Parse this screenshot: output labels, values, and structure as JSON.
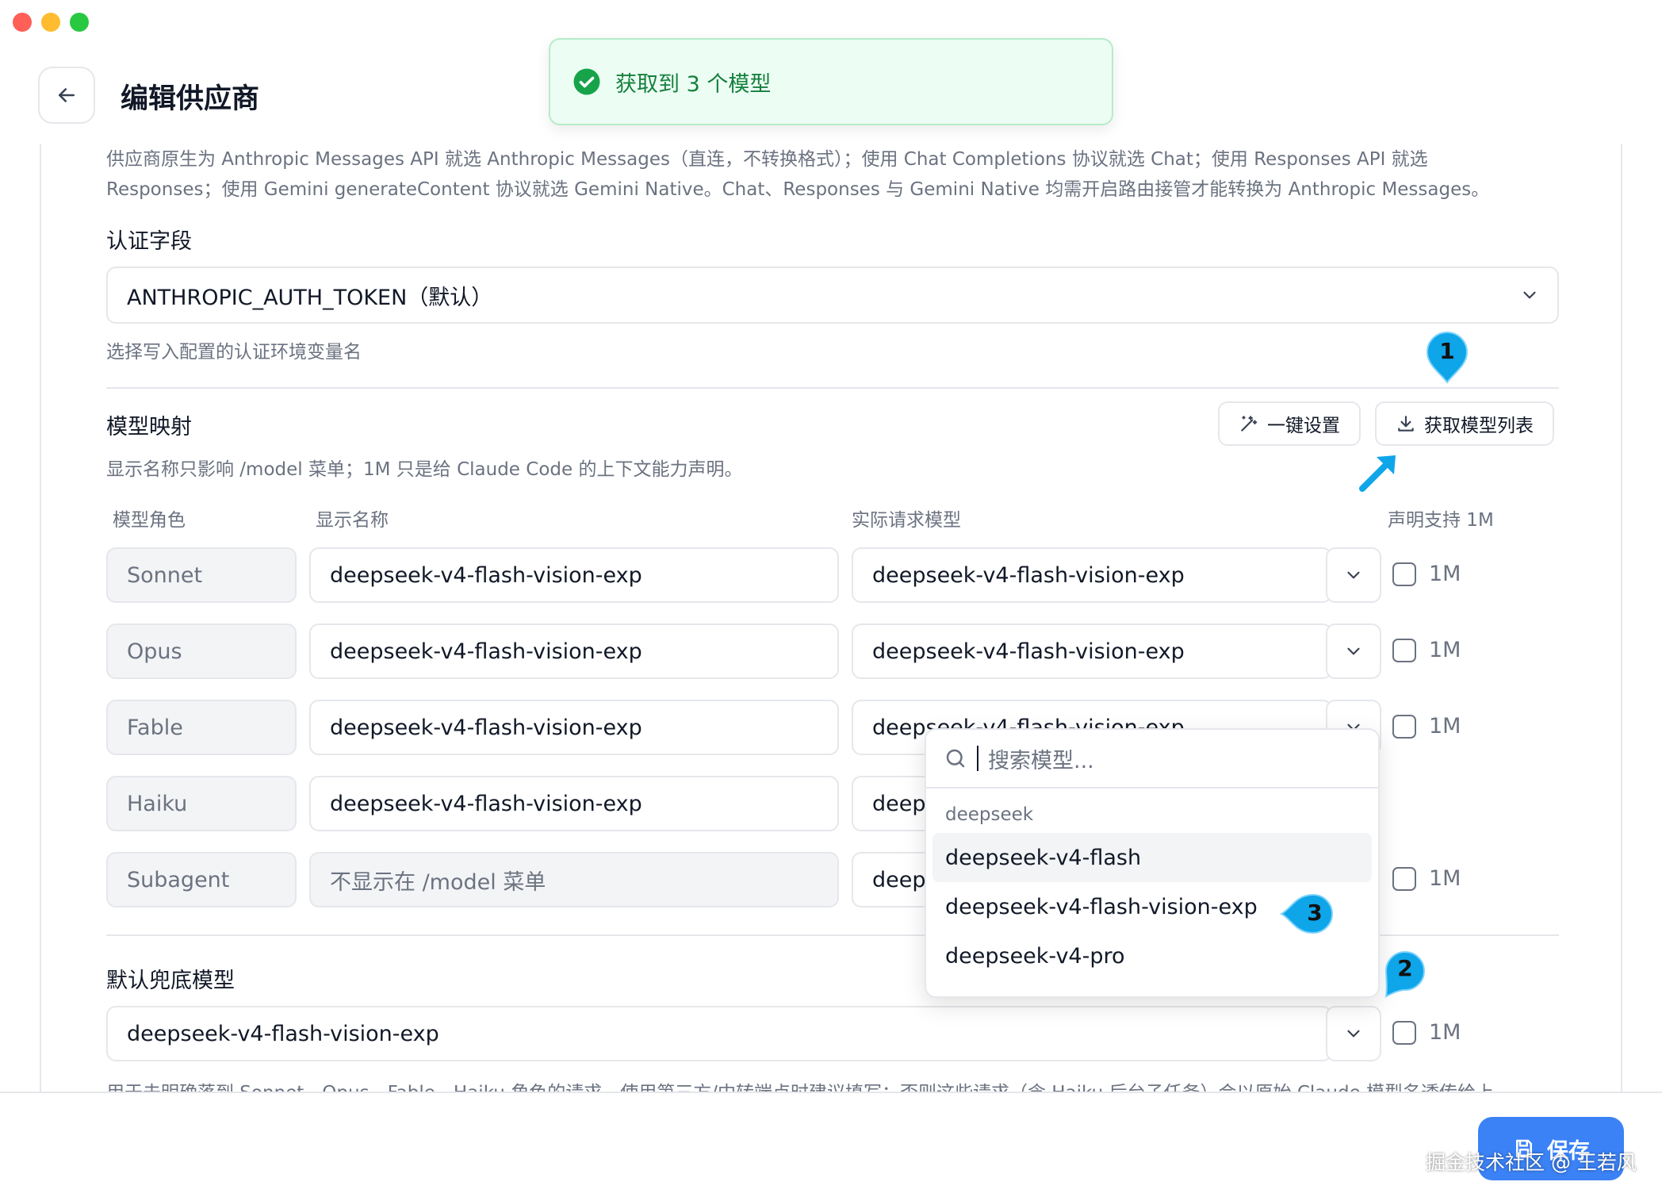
{
  "page": {
    "title": "编辑供应商"
  },
  "toast": {
    "text": "获取到 3 个模型"
  },
  "hint": {
    "line1": "供应商原生为 Anthropic Messages API 就选 Anthropic Messages（直连，不转换格式）；使用 Chat Completions 协议就选 Chat；使用 Responses API 就选",
    "line2": "Responses；使用 Gemini generateContent 协议就选 Gemini Native。Chat、Responses 与 Gemini Native 均需开启路由接管才能转换为 Anthropic Messages。"
  },
  "auth": {
    "label": "认证字段",
    "value": "ANTHROPIC_AUTH_TOKEN（默认）",
    "hint": "选择写入配置的认证环境变量名"
  },
  "mapping": {
    "label": "模型映射",
    "hint": "显示名称只影响 /model 菜单；1M 只是给 Claude Code 的上下文能力声明。",
    "quick_setup": "一键设置",
    "fetch_models": "获取模型列表",
    "columns": {
      "role": "模型角色",
      "display": "显示名称",
      "actual": "实际请求模型",
      "declare": "声明支持 1M"
    },
    "rows": [
      {
        "role": "Sonnet",
        "display": "deepseek-v4-flash-vision-exp",
        "actual": "deepseek-v4-flash-vision-exp",
        "flag": "1M"
      },
      {
        "role": "Opus",
        "display": "deepseek-v4-flash-vision-exp",
        "actual": "deepseek-v4-flash-vision-exp",
        "flag": "1M"
      },
      {
        "role": "Fable",
        "display": "deepseek-v4-flash-vision-exp",
        "actual": "deepseek-v4-flash-vision-exp",
        "flag": "1M"
      },
      {
        "role": "Haiku",
        "display": "deepseek-v4-flash-vision-exp",
        "actual": "deep",
        "flag": ""
      },
      {
        "role": "Subagent",
        "display": "",
        "display_placeholder": "不显示在 /model 菜单",
        "actual": "deep",
        "flag": "1M"
      }
    ]
  },
  "fallback": {
    "label": "默认兜底模型",
    "value": "deepseek-v4-flash-vision-exp",
    "flag": "1M",
    "hint": "用于未明确落到 Sonnet、Opus、Fable、Haiku 角色的请求。使用第三方/中转端点时建议填写；否则这些请求（含 Haiku 后台子任务）会以原始 Claude 模型名透传给上"
  },
  "dropdown": {
    "search_placeholder": "搜索模型...",
    "group": "deepseek",
    "items": [
      "deepseek-v4-flash",
      "deepseek-v4-flash-vision-exp",
      "deepseek-v4-pro"
    ]
  },
  "annotations": {
    "badge1": "1",
    "badge2": "2",
    "badge3": "3"
  },
  "footer": {
    "save": "保存",
    "watermark": "掘金技术社区 @ 王若风"
  },
  "colors": {
    "accent": "#3b82f6",
    "success": "#15803d",
    "badge": "#0ea5e9"
  }
}
